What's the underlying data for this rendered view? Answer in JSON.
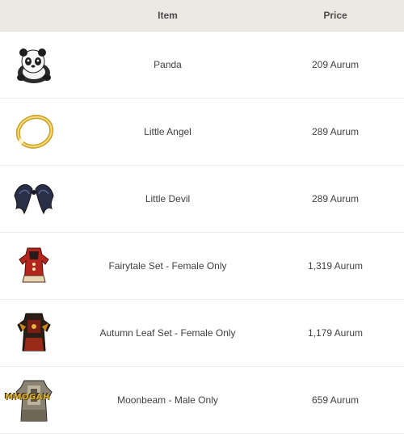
{
  "table": {
    "header": {
      "item": "Item",
      "price": "Price"
    },
    "rows": [
      {
        "icon": "panda-icon",
        "item": "Panda",
        "price": "209 Aurum"
      },
      {
        "icon": "halo-icon",
        "item": "Little Angel",
        "price": "289 Aurum"
      },
      {
        "icon": "bat-wings-icon",
        "item": "Little Devil",
        "price": "289 Aurum"
      },
      {
        "icon": "red-dress-icon",
        "item": "Fairytale Set - Female Only",
        "price": "1,319 Aurum"
      },
      {
        "icon": "leaf-costume-icon",
        "item": "Autumn Leaf Set - Female Only",
        "price": "1,179 Aurum"
      },
      {
        "icon": "moonbeam-armor-icon",
        "item": "Moonbeam - Male Only",
        "price": "659 Aurum"
      }
    ]
  },
  "watermark": "MMOGAH"
}
